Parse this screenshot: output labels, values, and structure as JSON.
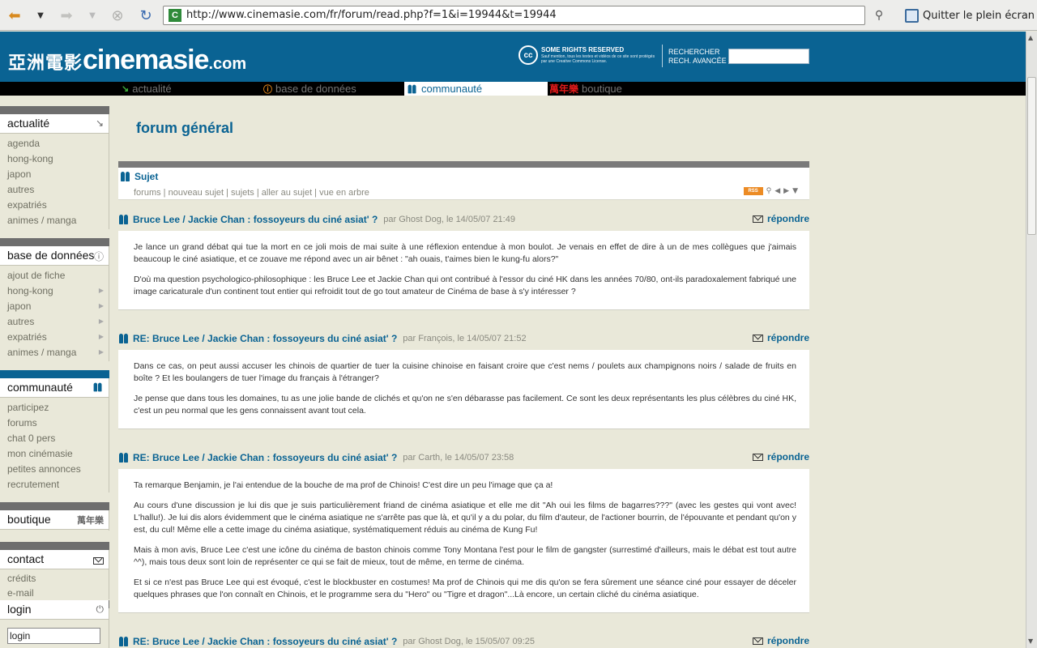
{
  "browser": {
    "url": "http://www.cinemasie.com/fr/forum/read.php?f=1&i=19944&t=19944",
    "fullscreen_label": "Quitter le plein écran"
  },
  "header": {
    "logo_cjk": "亞洲電影",
    "logo_main": "cinemasie",
    "logo_tld": ".com",
    "cc_badge": "cc",
    "cc_title": "SOME RIGHTS RESERVED",
    "cc_subtitle": "Sauf mention, tous les textes et vidéos de ce site sont protégés par une Creative Commons License.",
    "search_link": "RECHERCHER",
    "advanced_link": "RECH. AVANCÉE",
    "search_value": ""
  },
  "topnav": [
    {
      "label": "actualité",
      "icon": "↘"
    },
    {
      "label": "base de données",
      "icon": "ⓘ"
    },
    {
      "label": "communauté",
      "icon": "people"
    },
    {
      "label": "boutique",
      "icon": "萬年樂"
    }
  ],
  "sidebar": {
    "actualite": {
      "title": "actualité",
      "items": [
        "agenda",
        "hong-kong",
        "japon",
        "autres",
        "expatriés",
        "animes / manga"
      ]
    },
    "base": {
      "title": "base de données",
      "items": [
        "ajout de fiche",
        "hong-kong",
        "japon",
        "autres",
        "expatriés",
        "animes / manga"
      ]
    },
    "communaute": {
      "title": "communauté",
      "items": [
        "participez",
        "forums",
        "chat 0 pers",
        "mon cinémasie",
        "petites annonces",
        "recrutement"
      ]
    },
    "boutique": {
      "title": "boutique",
      "logo": "萬年樂"
    },
    "contact": {
      "title": "contact",
      "items": [
        "crédits",
        "e-mail"
      ]
    },
    "login": {
      "title": "login",
      "input_value": "login"
    }
  },
  "main": {
    "title": "forum général",
    "subject_label": "Sujet",
    "subject_links": "forums | nouveau sujet | sujets | aller au sujet | vue en arbre",
    "rss_label": "RSS",
    "reply_label": "répondre",
    "posts": [
      {
        "title": "Bruce Lee / Jackie Chan : fossoyeurs du ciné asiat' ?",
        "meta": "par Ghost Dog, le 14/05/07 21:49",
        "paragraphs": [
          "Je lance un grand débat qui tue la mort en ce joli mois de mai suite à une réflexion entendue à mon boulot. Je venais en effet de dire à un de mes collègues que j'aimais beaucoup le ciné asiatique, et ce zouave me répond avec un air bênet : \"ah ouais, t'aimes bien le kung-fu alors?\"",
          "D'où ma question psychologico-philosophique : les Bruce Lee et Jackie Chan qui ont contribué à l'essor du ciné HK dans les années 70/80, ont-ils paradoxalement fabriqué une image caricaturale d'un continent tout entier qui refroidit tout de go tout amateur de Cinéma de base à s'y intéresser ?"
        ]
      },
      {
        "title": "RE: Bruce Lee / Jackie Chan : fossoyeurs du ciné asiat' ?",
        "meta": "par François, le 14/05/07 21:52",
        "paragraphs": [
          "Dans ce cas, on peut aussi accuser les chinois de quartier de tuer la cuisine chinoise en faisant croire que c'est nems / poulets aux champignons noirs / salade de fruits en boîte ? Et les boulangers de tuer l'image du français à l'étranger?",
          "Je pense que dans tous les domaines, tu as une jolie bande de clichés et qu'on ne s'en débarasse pas facilement. Ce sont les deux représentants les plus célèbres du ciné HK, c'est un peu normal que les gens connaissent avant tout cela."
        ]
      },
      {
        "title": "RE: Bruce Lee / Jackie Chan : fossoyeurs du ciné asiat' ?",
        "meta": "par Carth, le 14/05/07 23:58",
        "paragraphs": [
          "Ta remarque Benjamin, je l'ai entendue de la bouche de ma prof de Chinois! C'est dire un peu l'image que ça a!",
          "Au cours d'une discussion je lui dis que je suis particulièrement friand de cinéma asiatique et elle me dit \"Ah oui les films de bagarres???\" (avec les gestes qui vont avec! L'hallu!). Je lui dis alors évidemment que le cinéma asiatique ne s'arrête pas que là, et qu'il y a du polar, du film d'auteur, de l'actioner bourrin, de l'épouvante et pendant qu'on y est, du cul! Même elle a cette image du cinéma asiatique, systématiquement réduis au cinéma de Kung Fu!",
          "Mais à mon avis, Bruce Lee c'est une icône du cinéma de baston chinois comme Tony Montana l'est pour le film de gangster (surrestimé d'ailleurs, mais le débat est tout autre ^^), mais tous deux sont loin de représenter ce qui se fait de mieux, tout de même, en terme de cinéma.",
          "Et si ce n'est pas Bruce Lee qui est évoqué, c'est le blockbuster en costumes! Ma prof de Chinois qui me dis qu'on se fera sûrement une séance ciné pour essayer de déceler quelques phrases que l'on connaît en Chinois, et le programme sera du \"Hero\" ou \"Tigre et dragon\"...Là encore, un certain cliché du cinéma asiatique."
        ]
      },
      {
        "title": "RE: Bruce Lee / Jackie Chan : fossoyeurs du ciné asiat' ?",
        "meta": "par Ghost Dog, le 15/05/07 09:25",
        "paragraphs": []
      }
    ]
  }
}
